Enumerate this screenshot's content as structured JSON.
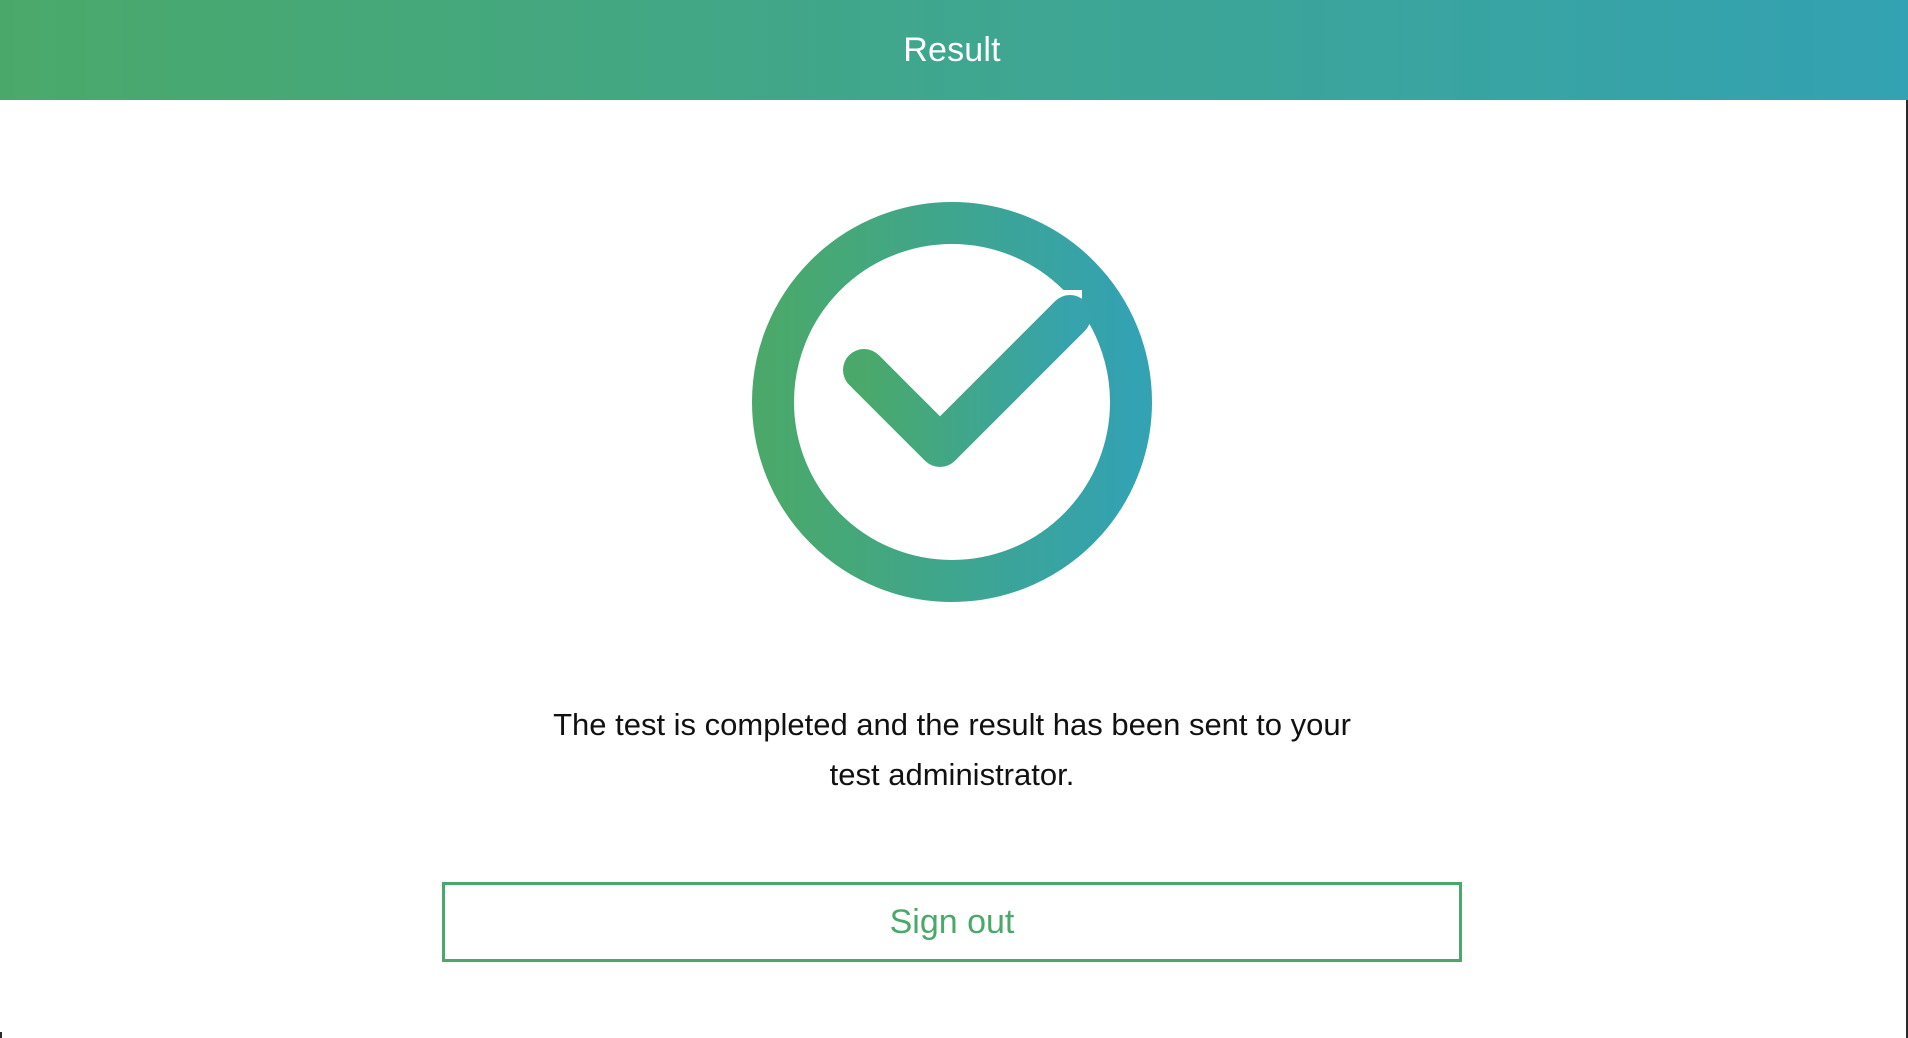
{
  "header": {
    "title": "Result"
  },
  "status_icon": {
    "name": "check-circle-icon",
    "gradient_start": "#4aa96a",
    "gradient_end": "#33a2b2"
  },
  "message": {
    "line1": "The test is completed and the result has been sent to your",
    "line2": "test administrator."
  },
  "actions": {
    "sign_out_label": "Sign out"
  },
  "colors": {
    "accent": "#4aa96a",
    "header_gradient_start": "#4aa96a",
    "header_gradient_end": "#33a2b2"
  }
}
